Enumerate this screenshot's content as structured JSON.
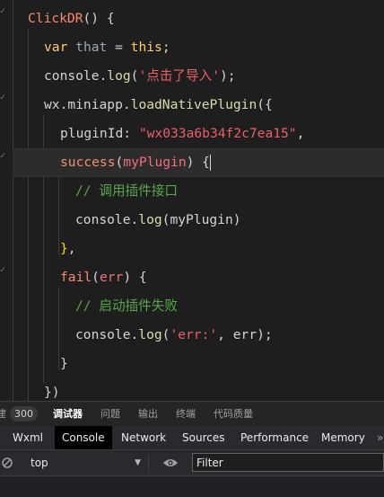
{
  "editor": {
    "lines": [
      {
        "segs": [
          [
            "fn",
            "ClickDR"
          ],
          [
            "txt",
            "() {"
          ]
        ]
      },
      {
        "segs": [
          [
            "kw",
            "var"
          ],
          [
            "txt",
            " "
          ],
          [
            "var",
            "that"
          ],
          [
            "txt",
            " = "
          ],
          [
            "this",
            "this"
          ],
          [
            "txt",
            ";"
          ]
        ]
      },
      {
        "segs": [
          [
            "txt",
            "console."
          ],
          [
            "fn2",
            "log"
          ],
          [
            "txt",
            "("
          ],
          [
            "strg",
            "'点击了导入'"
          ],
          [
            "txt",
            ");"
          ]
        ]
      },
      {
        "segs": [
          [
            "txt",
            "wx.miniapp."
          ],
          [
            "fn2",
            "loadNativePlugin"
          ],
          [
            "txt",
            "({"
          ]
        ]
      },
      {
        "segs": [
          [
            "txt",
            "pluginId: "
          ],
          [
            "strg",
            "\"wx033a6b34f2c7ea15\""
          ],
          [
            "txt",
            ","
          ]
        ]
      },
      {
        "segs": [
          [
            "fn",
            "success"
          ],
          [
            "txt",
            "("
          ],
          [
            "param",
            "myPlugin"
          ],
          [
            "txt",
            ") {"
          ]
        ]
      },
      {
        "segs": [
          [
            "com",
            "// 调用插件接口"
          ]
        ]
      },
      {
        "segs": [
          [
            "txt",
            "console."
          ],
          [
            "fn2",
            "log"
          ],
          [
            "txt",
            "(myPlugin)"
          ]
        ]
      },
      {
        "segs": [
          [
            "brk",
            "}"
          ],
          [
            "txt",
            ","
          ]
        ]
      },
      {
        "segs": [
          [
            "fn",
            "fail"
          ],
          [
            "txt",
            "("
          ],
          [
            "param",
            "err"
          ],
          [
            "txt",
            ") {"
          ]
        ]
      },
      {
        "segs": [
          [
            "com",
            "// 启动插件失败"
          ]
        ]
      },
      {
        "segs": [
          [
            "txt",
            "console."
          ],
          [
            "fn2",
            "log"
          ],
          [
            "txt",
            "("
          ],
          [
            "strg",
            "'err:'"
          ],
          [
            "txt",
            ", err);"
          ]
        ]
      },
      {
        "segs": [
          [
            "txt",
            "}"
          ]
        ]
      },
      {
        "segs": [
          [
            "txt",
            "})"
          ]
        ]
      }
    ]
  },
  "panel_tabs": {
    "partial_left": "建",
    "badge": "300",
    "debugger": "调试器",
    "issues": "问题",
    "output": "输出",
    "terminal": "终端",
    "code_quality": "代码质量"
  },
  "devtools_tabs": {
    "wxml": "Wxml",
    "console": "Console",
    "network": "Network",
    "sources": "Sources",
    "performance": "Performance",
    "memory": "Memory"
  },
  "console_toolbar": {
    "context": "top",
    "filter_placeholder": "Filter"
  }
}
